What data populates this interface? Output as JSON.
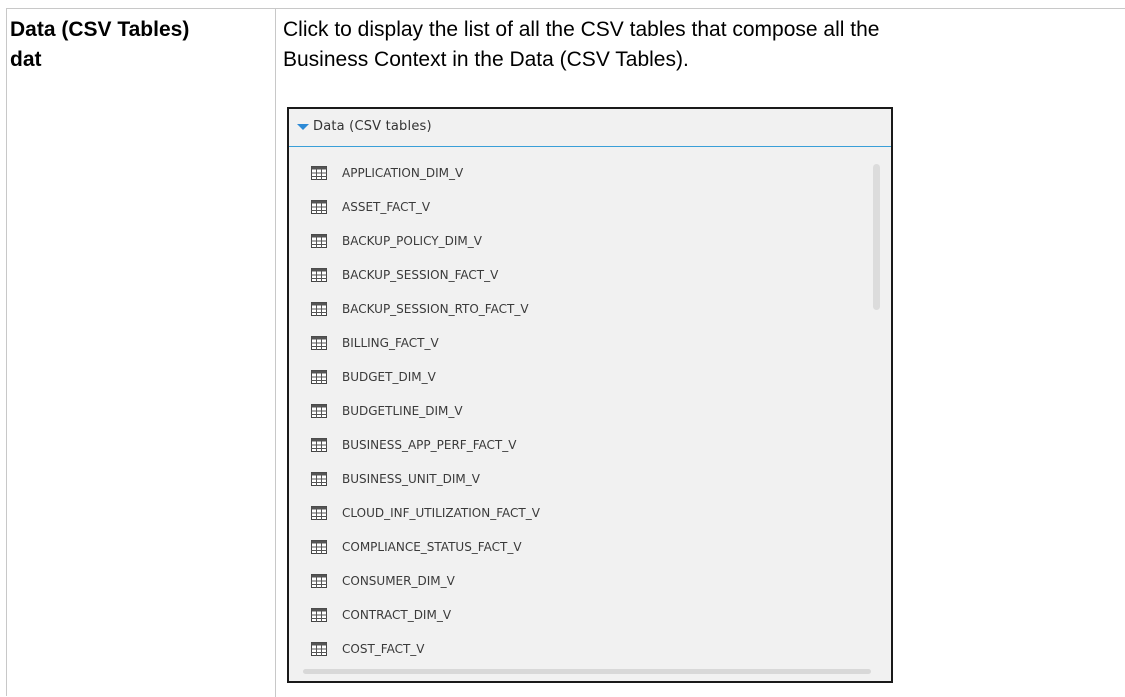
{
  "row": {
    "term_line1": "Data (CSV Tables)",
    "term_line2": "dat",
    "description_line1": "Click to display the list of all the CSV tables that compose all the",
    "description_line2": "Business Context in the Data (CSV Tables)."
  },
  "panel": {
    "title": "Data (CSV tables)",
    "expand_icon": "caret-down-icon",
    "item_icon": "table-icon",
    "accent_color": "#3a9fd8",
    "items": [
      "APPLICATION_DIM_V",
      "ASSET_FACT_V",
      "BACKUP_POLICY_DIM_V",
      "BACKUP_SESSION_FACT_V",
      "BACKUP_SESSION_RTO_FACT_V",
      "BILLING_FACT_V",
      "BUDGET_DIM_V",
      "BUDGETLINE_DIM_V",
      "BUSINESS_APP_PERF_FACT_V",
      "BUSINESS_UNIT_DIM_V",
      "CLOUD_INF_UTILIZATION_FACT_V",
      "COMPLIANCE_STATUS_FACT_V",
      "CONSUMER_DIM_V",
      "CONTRACT_DIM_V",
      "COST_FACT_V"
    ]
  }
}
